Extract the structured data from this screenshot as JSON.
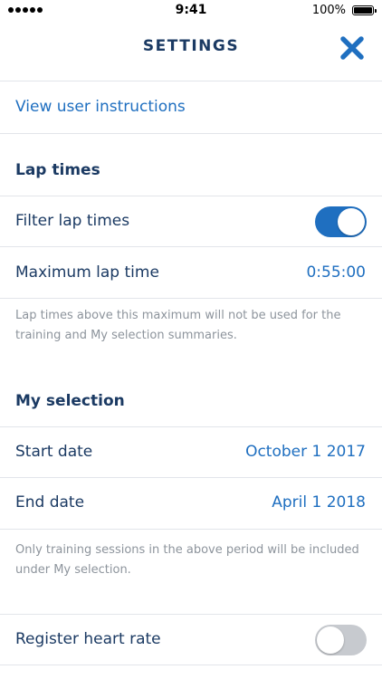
{
  "status_bar": {
    "time": "9:41",
    "battery_percent": "100%",
    "signal_icon": "signal-dots-icon",
    "battery_icon": "battery-full-icon"
  },
  "header": {
    "title": "SETTINGS",
    "close_icon": "close-icon",
    "accent_color": "#1f6fc0"
  },
  "links": {
    "view_instructions": "View user instructions"
  },
  "lap_times": {
    "section_title": "Lap times",
    "filter_label": "Filter lap times",
    "filter_enabled": true,
    "max_label": "Maximum lap time",
    "max_value": "0:55:00",
    "note": "Lap times above this maximum will not be used for the training and My selection summaries."
  },
  "my_selection": {
    "section_title": "My selection",
    "start_label": "Start date",
    "start_value": "October 1 2017",
    "end_label": "End date",
    "end_value": "April 1 2018",
    "note": "Only training sessions in the above period will be included under My selection."
  },
  "heart_rate": {
    "label": "Register heart rate",
    "enabled": false
  }
}
